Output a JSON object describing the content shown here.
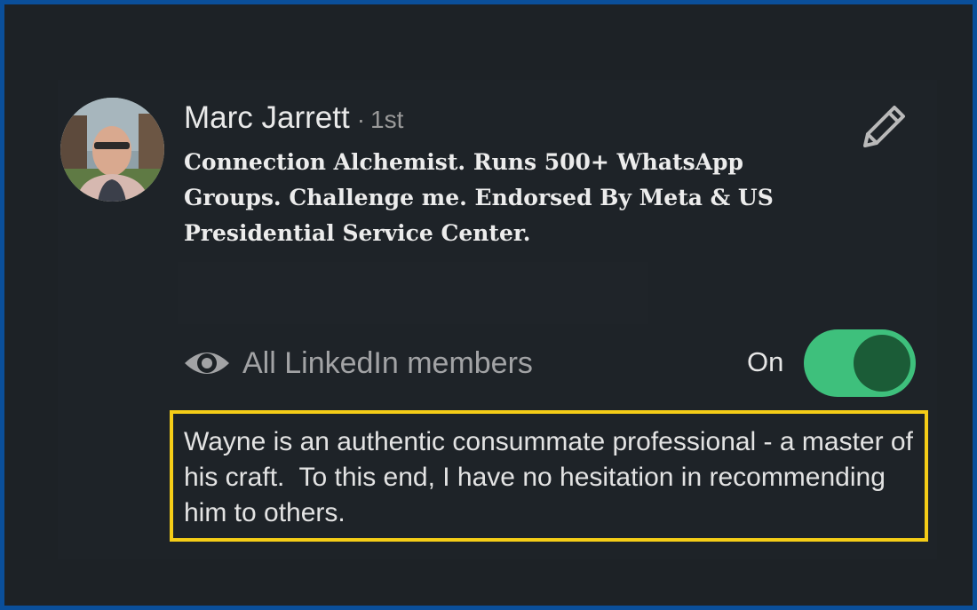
{
  "recommendation_card": {
    "author": {
      "name": "Marc Jarrett",
      "separator": "·",
      "degree": "1st",
      "headline": "Connection Alchemist. Runs 500+ WhatsApp Groups. Challenge me. Endorsed By Meta & US Presidential Service Center."
    },
    "edit_icon": "pencil-icon",
    "visibility": {
      "icon": "eye-icon",
      "label": "All LinkedIn members",
      "toggle_label": "On",
      "toggle_on": true
    },
    "recommendation_text": "Wayne is an authentic consummate professional - a master of his craft.  To this end, I have no hesitation in recommending him to others."
  },
  "colors": {
    "frame_border": "#0a4f9a",
    "background": "#1d2226",
    "highlight_border": "#f5cd17",
    "toggle_track": "#3ec07c",
    "toggle_knob": "#1b5c37"
  }
}
